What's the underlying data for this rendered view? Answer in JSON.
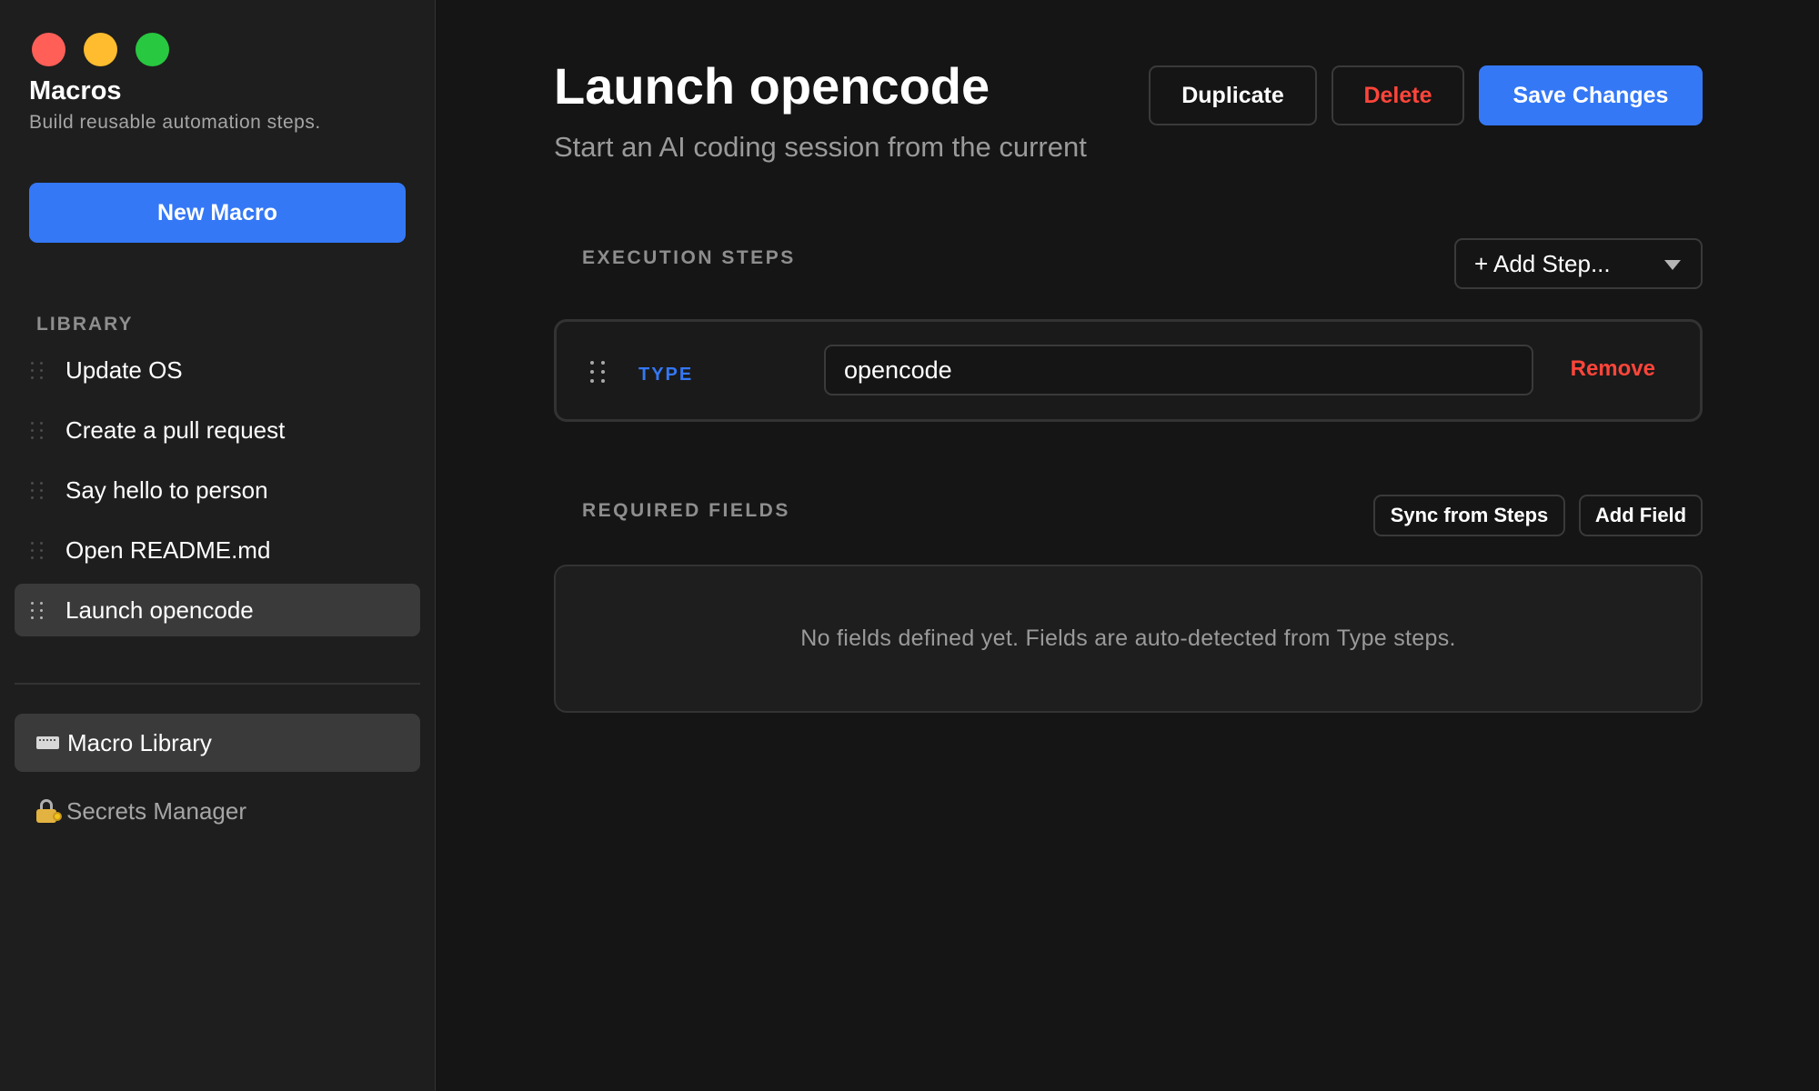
{
  "sidebar": {
    "app_title": "Macros",
    "app_subtitle": "Build reusable automation steps.",
    "new_macro_label": "New Macro",
    "library_header": "LIBRARY",
    "library_items": [
      {
        "label": "Update OS",
        "active": false
      },
      {
        "label": "Create a pull request",
        "active": false
      },
      {
        "label": "Say hello to person",
        "active": false
      },
      {
        "label": "Open README.md",
        "active": false
      },
      {
        "label": "Launch opencode",
        "active": true
      }
    ],
    "nav": {
      "macro_library": {
        "label": "Macro Library",
        "icon": "keyboard-icon",
        "active": true
      },
      "secrets_manager": {
        "label": "Secrets Manager",
        "icon": "lock-key-icon",
        "active": false
      }
    }
  },
  "main": {
    "title": "Launch opencode",
    "subtitle": "Start an AI coding session from the current",
    "actions": {
      "duplicate": "Duplicate",
      "delete": "Delete",
      "save": "Save Changes"
    },
    "execution_steps": {
      "header": "EXECUTION STEPS",
      "add_step_label": "+ Add Step...",
      "steps": [
        {
          "type": "TYPE",
          "value": "opencode",
          "remove_label": "Remove"
        }
      ]
    },
    "required_fields": {
      "header": "REQUIRED FIELDS",
      "sync_label": "Sync from Steps",
      "add_field_label": "Add Field",
      "empty_message": "No fields defined yet. Fields are auto-detected from Type steps."
    }
  },
  "colors": {
    "accent": "#3478f6",
    "danger": "#ff453a",
    "traffic_red": "#ff5f57",
    "traffic_yellow": "#febc2e",
    "traffic_green": "#28c840"
  }
}
